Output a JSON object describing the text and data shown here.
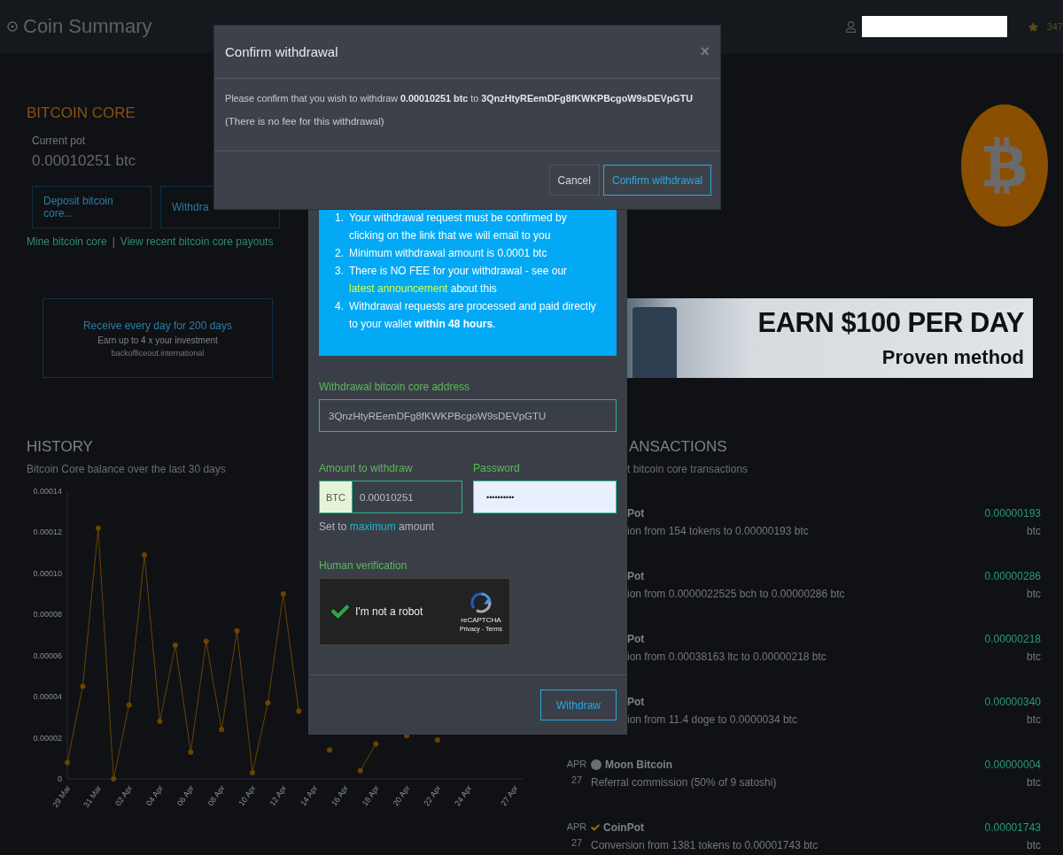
{
  "header": {
    "title": "Coin Summary",
    "points": "347"
  },
  "coin": {
    "name": "BITCOIN CORE",
    "pot_label": "Current pot",
    "pot_value": "0.00010251 btc",
    "buttons": [
      "Deposit bitcoin core...",
      "Withdra"
    ],
    "links": [
      "Mine bitcoin core",
      "View recent bitcoin core payouts"
    ],
    "separator": "|"
  },
  "ad": {
    "title": "Receive every day for 200 days",
    "text": "Earn up to 4 x your investment",
    "url": "backofficeout.international"
  },
  "banner": {
    "headline": "EARN $100 PER DAY",
    "tagline": "Proven method"
  },
  "history": {
    "title": "HISTORY",
    "subtitle": "Bitcoin Core balance over the last 30 days",
    "chart_data": {
      "type": "line",
      "categories": [
        "29 Mar",
        null,
        "31 Mar",
        null,
        "02 Apr",
        null,
        "04 Apr",
        null,
        "06 Apr",
        null,
        "08 Apr",
        null,
        "10 Apr",
        null,
        "12 Apr",
        null,
        "14 Apr",
        null,
        "16 Apr",
        null,
        "18 Apr",
        null,
        "20 Apr",
        null,
        "22 Apr",
        null,
        "24 Apr",
        null,
        null,
        "27 Apr"
      ],
      "series": [
        {
          "color": "#6b4300",
          "marker": true,
          "values": [
            8e-06,
            4.5e-05,
            0.000122,
            0,
            3.6e-05,
            0.000109,
            2.8e-05,
            6.5e-05,
            1.3e-05,
            6.7e-05,
            2.4e-05,
            7.2e-05,
            3e-06,
            3.7e-05,
            9e-05,
            3.3e-05,
            null,
            1.4e-05,
            null,
            4e-06,
            1.7e-05,
            null,
            2.1e-05,
            null,
            1.9e-05,
            null,
            null,
            null,
            null,
            null
          ]
        }
      ],
      "ylim": [
        0,
        0.00014
      ],
      "yticks": [
        {
          "value": 0,
          "label": "0"
        },
        {
          "value": 2e-05,
          "label": "0.00002"
        },
        {
          "value": 4e-05,
          "label": "0.00004"
        },
        {
          "value": 6e-05,
          "label": "0.00006"
        },
        {
          "value": 8e-05,
          "label": "0.00008"
        },
        {
          "value": 0.0001,
          "label": "0.00010"
        },
        {
          "value": 0.00012,
          "label": "0.00012"
        },
        {
          "value": 0.00014,
          "label": "0.00014"
        }
      ]
    }
  },
  "transactions": {
    "title": "ANSACTIONS",
    "subtitle": "t bitcoin core transactions",
    "items": [
      {
        "kind": "clipped",
        "source": "Pot",
        "description": "ion from 154 tokens to 0.00000193 btc",
        "amount": "0.00000193",
        "unit": "btc"
      },
      {
        "kind": "clipped",
        "source": "Pot",
        "description": "ion from 0.0000022525 bch to 0.00000286 btc",
        "amount": "0.00000286",
        "unit": "btc"
      },
      {
        "kind": "clipped",
        "source": "Pot",
        "description": "ion from 0.00038163 ltc to 0.00000218 btc",
        "amount": "0.00000218",
        "unit": "btc"
      },
      {
        "kind": "clipped",
        "source": "Pot",
        "description": "ion from 11.4 doge to 0.0000034 btc",
        "amount": "0.00000340",
        "unit": "btc"
      },
      {
        "kind": "referral",
        "month": "APR",
        "day": "27",
        "source": "Moon Bitcoin",
        "description": "Referral commission (50% of 9 satoshi)",
        "amount": "0.00000004",
        "unit": "btc"
      },
      {
        "kind": "conversion",
        "month": "APR",
        "day": "27",
        "source": "CoinPot",
        "description": "Conversion from 1381 tokens to 0.00001743 btc",
        "amount": "0.00001743",
        "unit": "btc"
      }
    ]
  },
  "withdraw_dialog": {
    "notes": [
      {
        "number": "1.",
        "text": "Your withdrawal request must be confirmed by clicking on the link that we will email to you"
      },
      {
        "number": "2.",
        "text": "Minimum withdrawal amount is 0.0001 btc"
      },
      {
        "number": "3.",
        "text": "There is NO FEE for your withdrawal - see our ",
        "link": "latest announcement",
        "after": " about this"
      },
      {
        "number": "4.",
        "text": "Withdrawal requests are processed and paid directly to your wallet **within 48 hours**."
      }
    ],
    "address": {
      "label": "Withdrawal bitcoin core address",
      "value": "3QnzHtyREemDFg8fKWKPBcgoW9sDEVpGTU"
    },
    "amount": {
      "label": "Amount to withdraw",
      "currency": "BTC",
      "value": "0.00010251"
    },
    "password": {
      "label": "Password",
      "value": "••••••••••"
    },
    "max_hint": {
      "before": "Set to ",
      "link": "maximum",
      "after": " amount"
    },
    "verification": {
      "label": "Human verification",
      "checked": true,
      "text": "I'm not a robot",
      "brand": "reCAPTCHA",
      "links": "Privacy - Terms"
    },
    "submit": "Withdraw"
  },
  "confirm_dialog": {
    "title": "Confirm withdrawal",
    "close": "×",
    "message": "Please confirm that you wish to withdraw **0.00010251 btc** to **3QnzHtyREemDFg8fKWKPBcgoW9sDEVpGTU**",
    "note": "(There is no fee for this withdrawal)",
    "buttons": [
      {
        "label": "Cancel",
        "kind": "default"
      },
      {
        "label": "Confirm withdrawal",
        "kind": "primary"
      }
    ]
  }
}
